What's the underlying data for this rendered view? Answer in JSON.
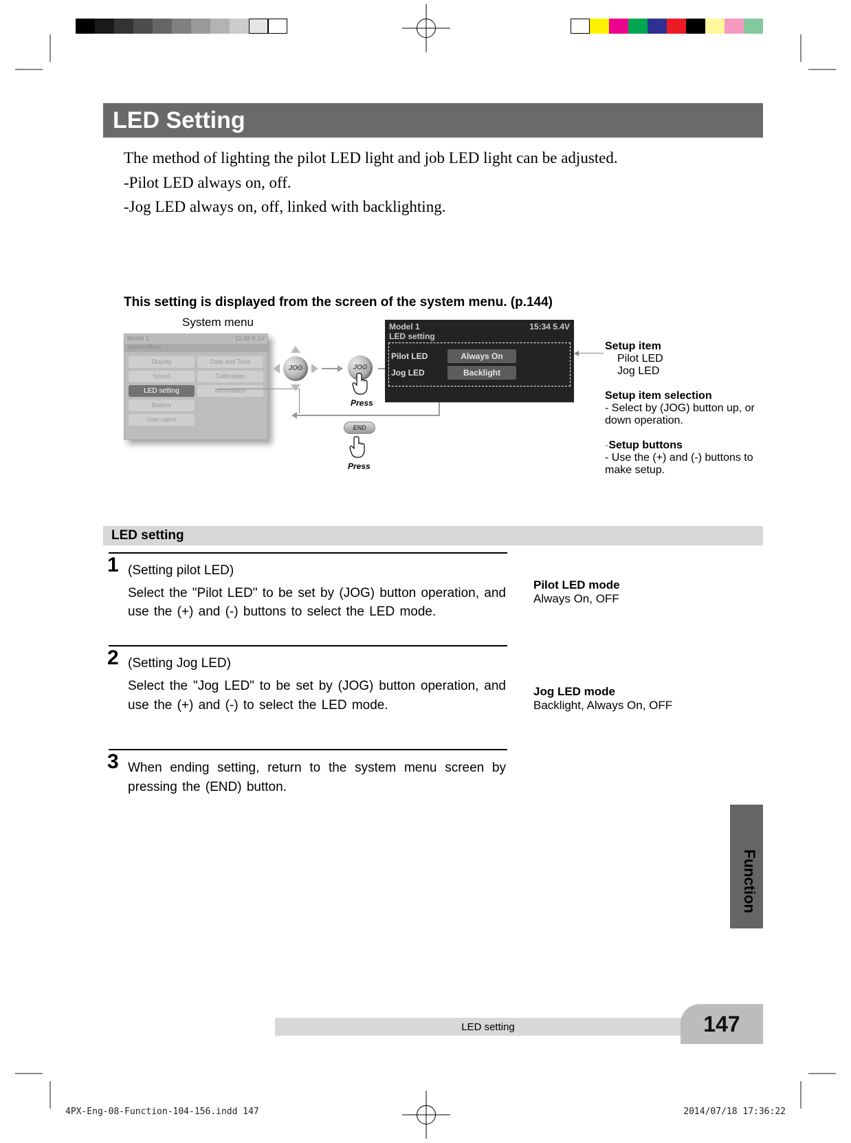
{
  "printer": {
    "grayscale": [
      "#000000",
      "#1a1a1a",
      "#333333",
      "#4d4d4d",
      "#666666",
      "#808080",
      "#999999",
      "#b3b3b3",
      "#cccccc",
      "#e6e6e6",
      "#ffffff"
    ],
    "colorscale": [
      "#ffffff",
      "#fff200",
      "#ec008c",
      "#00a651",
      "#2e3192",
      "#ed1c24",
      "#000000",
      "#fff799",
      "#f49ac1",
      "#82ca9c"
    ]
  },
  "title": "LED Setting",
  "intro1": "The method of lighting the pilot LED light and job LED light can be adjusted.",
  "intro2": "-Pilot LED always on, off.",
  "intro3": "-Jog LED always on, off, linked with backlighting.",
  "subhead": "This setting is displayed from the screen of the system menu. (p.144)",
  "diagram": {
    "sysmenu_label": "System menu",
    "sm_model": "Model 1",
    "sm_clock": "11:39 8.1V",
    "sm_head": "System Menu",
    "cells": [
      "Display",
      "Date and Time",
      "Sound",
      "Calibration",
      "LED setting",
      "Information",
      "Battery",
      "",
      "User name",
      ""
    ],
    "sel_index": 4,
    "jog_label": "JOG",
    "press": "Press",
    "end_label": "END"
  },
  "lcd": {
    "model": "Model 1",
    "status": "15:34 5.4V",
    "screen": "LED setting",
    "row1_lbl": "Pilot LED",
    "row1_val": "Always On",
    "row2_lbl": "Jog LED",
    "row2_val": "Backlight"
  },
  "annot": {
    "setup_item": "Setup item",
    "item1": "Pilot LED",
    "item2": "Jog LED",
    "sel_h": "Setup item selection",
    "sel_t": "- Select by (JOG) button up, or down operation.",
    "btn_h": "Setup buttons",
    "btn_t": "- Use the (+) and (-) buttons to make setup."
  },
  "section_bar": "LED setting",
  "step1": {
    "num": "1",
    "title": "(Setting pilot LED)",
    "body": "Select the \"Pilot LED\" to be set by (JOG) button operation, and use the (+) and (-) buttons to select the LED mode.",
    "side_h": "Pilot LED mode",
    "side_t": "Always On, OFF"
  },
  "step2": {
    "num": "2",
    "title": "(Setting Jog LED)",
    "body": "Select the \"Jog LED\" to be set by (JOG) button operation, and use the (+) and (-) to select the LED mode.",
    "side_h": "Jog LED mode",
    "side_t": "Backlight, Always On, OFF"
  },
  "step3": {
    "num": "3",
    "body": "When ending setting, return to the system menu screen by pressing the (END) button."
  },
  "func_tab": "Function",
  "footer": "LED setting",
  "page_num": "147",
  "slug_left": "4PX-Eng-08-Function-104-156.indd   147",
  "slug_right": "2014/07/18   17:36:22"
}
